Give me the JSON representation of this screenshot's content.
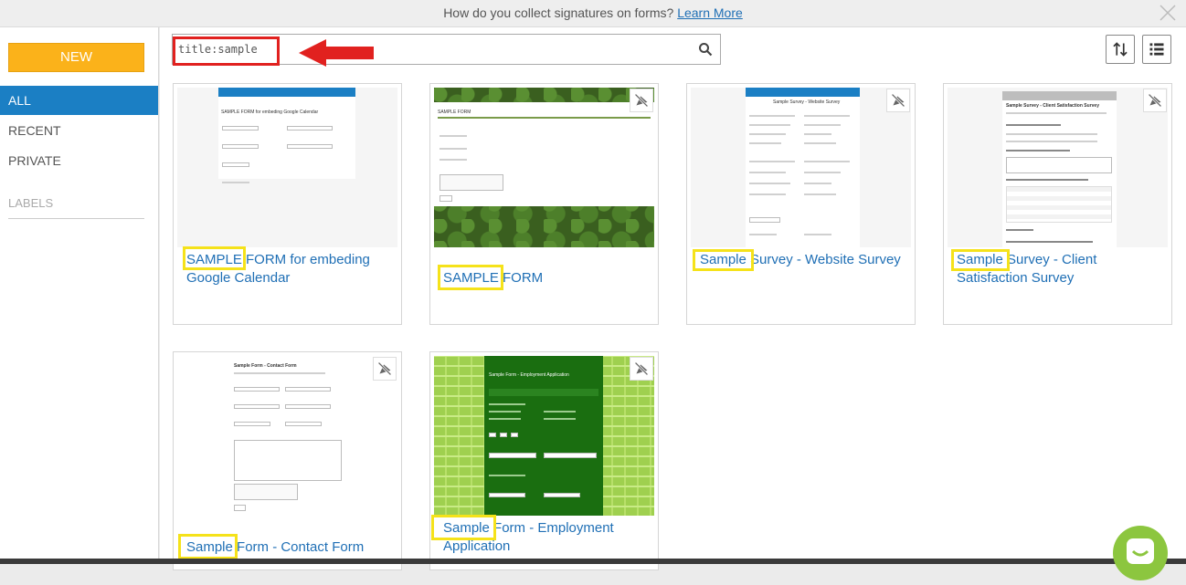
{
  "banner": {
    "text": "How do you collect signatures on forms?",
    "link": "Learn More"
  },
  "sidebar": {
    "new_label": "NEW",
    "items": [
      {
        "label": "ALL",
        "active": true
      },
      {
        "label": "RECENT",
        "active": false
      },
      {
        "label": "PRIVATE",
        "active": false
      }
    ],
    "labels_heading": "LABELS"
  },
  "search": {
    "value": "title:sample",
    "placeholder": ""
  },
  "forms": [
    {
      "title": "SAMPLE FORM for embeding Google Calendar",
      "thumb_heading": "SAMPLE FORM for embeding Google Calendar"
    },
    {
      "title": "SAMPLE FORM",
      "thumb_heading": "SAMPLE FORM"
    },
    {
      "title": "Sample Survey - Website Survey",
      "thumb_heading": "Sample Survey - Website Survey"
    },
    {
      "title": "Sample Survey - Client Satisfaction Survey",
      "thumb_heading": "Sample Survey - Client Satisfaction Survey"
    },
    {
      "title": "Sample Form - Contact Form",
      "thumb_heading": "Sample Form - Contact Form"
    },
    {
      "title": "Sample Form - Employment Application",
      "thumb_heading": "Sample Form - Employment Application"
    }
  ],
  "colors": {
    "accent": "#1b7fc4",
    "new_button": "#fbb21a",
    "highlight_red": "#e1211f",
    "highlight_yellow": "#f5e21a",
    "chat": "#8cc63f"
  },
  "icons": [
    "close-icon",
    "search-icon",
    "sort-icon",
    "list-view-icon",
    "unpublished-icon",
    "chat-icon"
  ]
}
